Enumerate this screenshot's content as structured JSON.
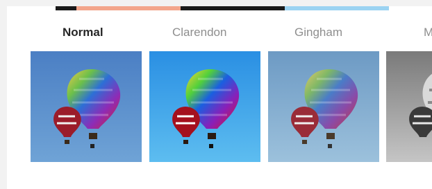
{
  "filters": [
    {
      "label": "Normal",
      "selected": true
    },
    {
      "label": "Clarendon",
      "selected": false
    },
    {
      "label": "Gingham",
      "selected": false
    },
    {
      "label": "M",
      "selected": false
    }
  ],
  "colors": {
    "normal_sky_top": "#4b7fc4",
    "normal_sky_bottom": "#6fa3d6",
    "clarendon_sky_top": "#2a8fe3",
    "clarendon_sky_bottom": "#5dbdf0",
    "gingham_sky_top": "#6d9ac4",
    "gingham_sky_bottom": "#9cc1dc",
    "mono_top": "#7a7a7a",
    "mono_bottom": "#c5c5c5",
    "strip": [
      "#1a1a1a",
      "#f3a58b",
      "#1a1a1a",
      "#9bd3f2"
    ]
  }
}
